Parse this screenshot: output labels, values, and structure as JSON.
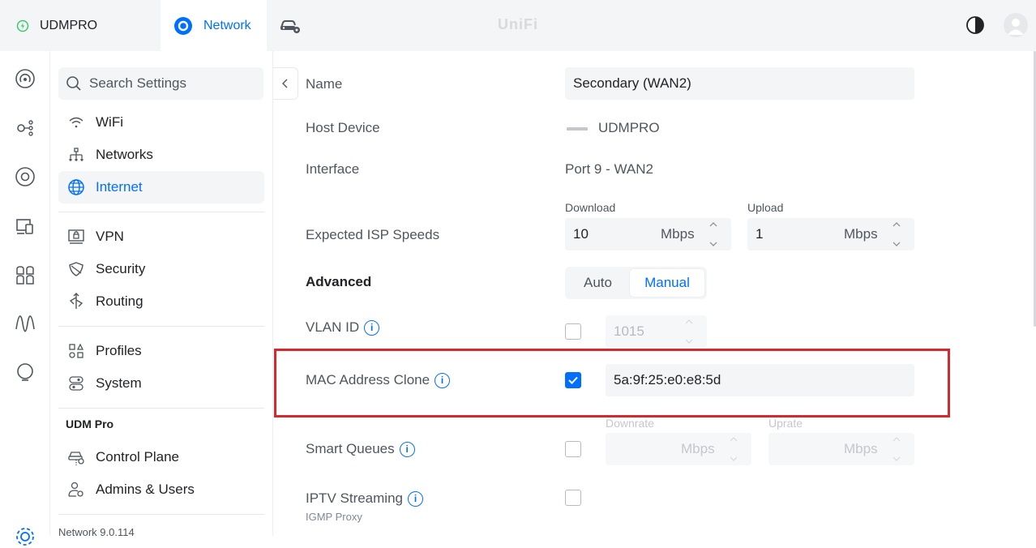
{
  "topbar": {
    "console_name": "UDMPRO",
    "app_name": "Network",
    "brand": "UniFi"
  },
  "icons": {
    "console": "power-icon",
    "network_app": "network-app-icon",
    "innerspace": "vehicle-gear-icon",
    "theme": "contrast-icon",
    "avatar": "user-avatar"
  },
  "sidebar": {
    "search_placeholder": "Search Settings",
    "group1": [
      {
        "label": "WiFi",
        "icon": "wifi-icon"
      },
      {
        "label": "Networks",
        "icon": "network-tree-icon"
      },
      {
        "label": "Internet",
        "icon": "globe-icon",
        "active": true
      }
    ],
    "group2": [
      {
        "label": "VPN",
        "icon": "vpn-icon"
      },
      {
        "label": "Security",
        "icon": "shield-icon"
      },
      {
        "label": "Routing",
        "icon": "routing-icon"
      }
    ],
    "group3": [
      {
        "label": "Profiles",
        "icon": "profiles-icon"
      },
      {
        "label": "System",
        "icon": "system-icon"
      }
    ],
    "section_title": "UDM Pro",
    "group4": [
      {
        "label": "Control Plane",
        "icon": "control-plane-icon"
      },
      {
        "label": "Admins & Users",
        "icon": "admins-icon"
      }
    ],
    "version": "Network 9.0.114"
  },
  "form": {
    "name_label": "Name",
    "name_value": "Secondary (WAN2)",
    "host_label": "Host Device",
    "host_value": "UDMPRO",
    "interface_label": "Interface",
    "interface_value": "Port 9 - WAN2",
    "isp_label": "Expected ISP Speeds",
    "download_label": "Download",
    "download_value": "10",
    "upload_label": "Upload",
    "upload_value": "1",
    "unit": "Mbps",
    "advanced_label": "Advanced",
    "advanced_options": [
      "Auto",
      "Manual"
    ],
    "advanced_selected": "Manual",
    "vlan_label": "VLAN ID",
    "vlan_value": "1015",
    "vlan_checked": false,
    "mac_label": "MAC Address Clone",
    "mac_value": "5a:9f:25:e0:e8:5d",
    "mac_checked": true,
    "smartq_label": "Smart Queues",
    "smartq_checked": false,
    "downrate_label": "Downrate",
    "uprate_label": "Uprate",
    "iptv_label": "IPTV Streaming",
    "iptv_sub": "IGMP Proxy",
    "iptv_checked": false,
    "info_glyph": "i"
  },
  "colors": {
    "accent": "#006fff",
    "highlight": "#d9272e",
    "topbar_bg": "#f4f5f6"
  }
}
